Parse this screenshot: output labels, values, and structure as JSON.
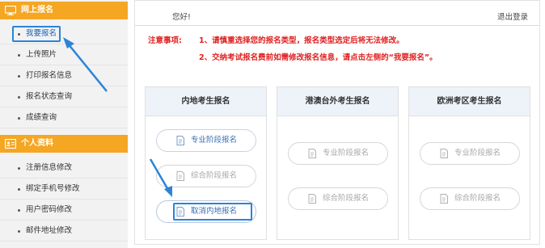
{
  "sidebar": {
    "section1": {
      "title": "网上报名",
      "icon": "monitor-icon"
    },
    "section1_items": [
      {
        "label": "我要报名",
        "active": true
      },
      {
        "label": "上传照片"
      },
      {
        "label": "打印报名信息"
      },
      {
        "label": "报名状态查询"
      },
      {
        "label": "成绩查询"
      }
    ],
    "section2": {
      "title": "个人资料",
      "icon": "id-card-icon"
    },
    "section2_items": [
      {
        "label": "注册信息修改"
      },
      {
        "label": "绑定手机号修改"
      },
      {
        "label": "用户密码修改"
      },
      {
        "label": "邮件地址修改"
      }
    ]
  },
  "header": {
    "greeting": "您好!",
    "logout": "退出登录"
  },
  "notice": {
    "label": "注意事项:",
    "items": [
      "1、请慎重选择您的报名类型，报名类型选定后将无法修改。",
      "2、交纳考试报名费前如需修改报名信息，请点击左侧的“我要报名”。"
    ]
  },
  "panels": [
    {
      "title": "内地考生报名",
      "buttons": [
        {
          "label": "专业阶段报名",
          "state": "enabled"
        },
        {
          "label": "综合阶段报名",
          "state": "disabled"
        },
        {
          "label": "取消内地报名",
          "state": "enabled"
        }
      ]
    },
    {
      "title": "港澳台外考生报名",
      "buttons": [
        {
          "label": "专业阶段报名",
          "state": "disabled"
        },
        {
          "label": "综合阶段报名",
          "state": "disabled"
        }
      ]
    },
    {
      "title": "欧洲考区考生报名",
      "buttons": [
        {
          "label": "专业阶段报名",
          "state": "disabled"
        },
        {
          "label": "综合阶段报名",
          "state": "disabled"
        }
      ]
    }
  ],
  "colors": {
    "sidebar_header": "#f5a623",
    "notice_text": "#e02020",
    "highlight": "#2b84d8",
    "panel_header_bg": "#eef3fa"
  }
}
